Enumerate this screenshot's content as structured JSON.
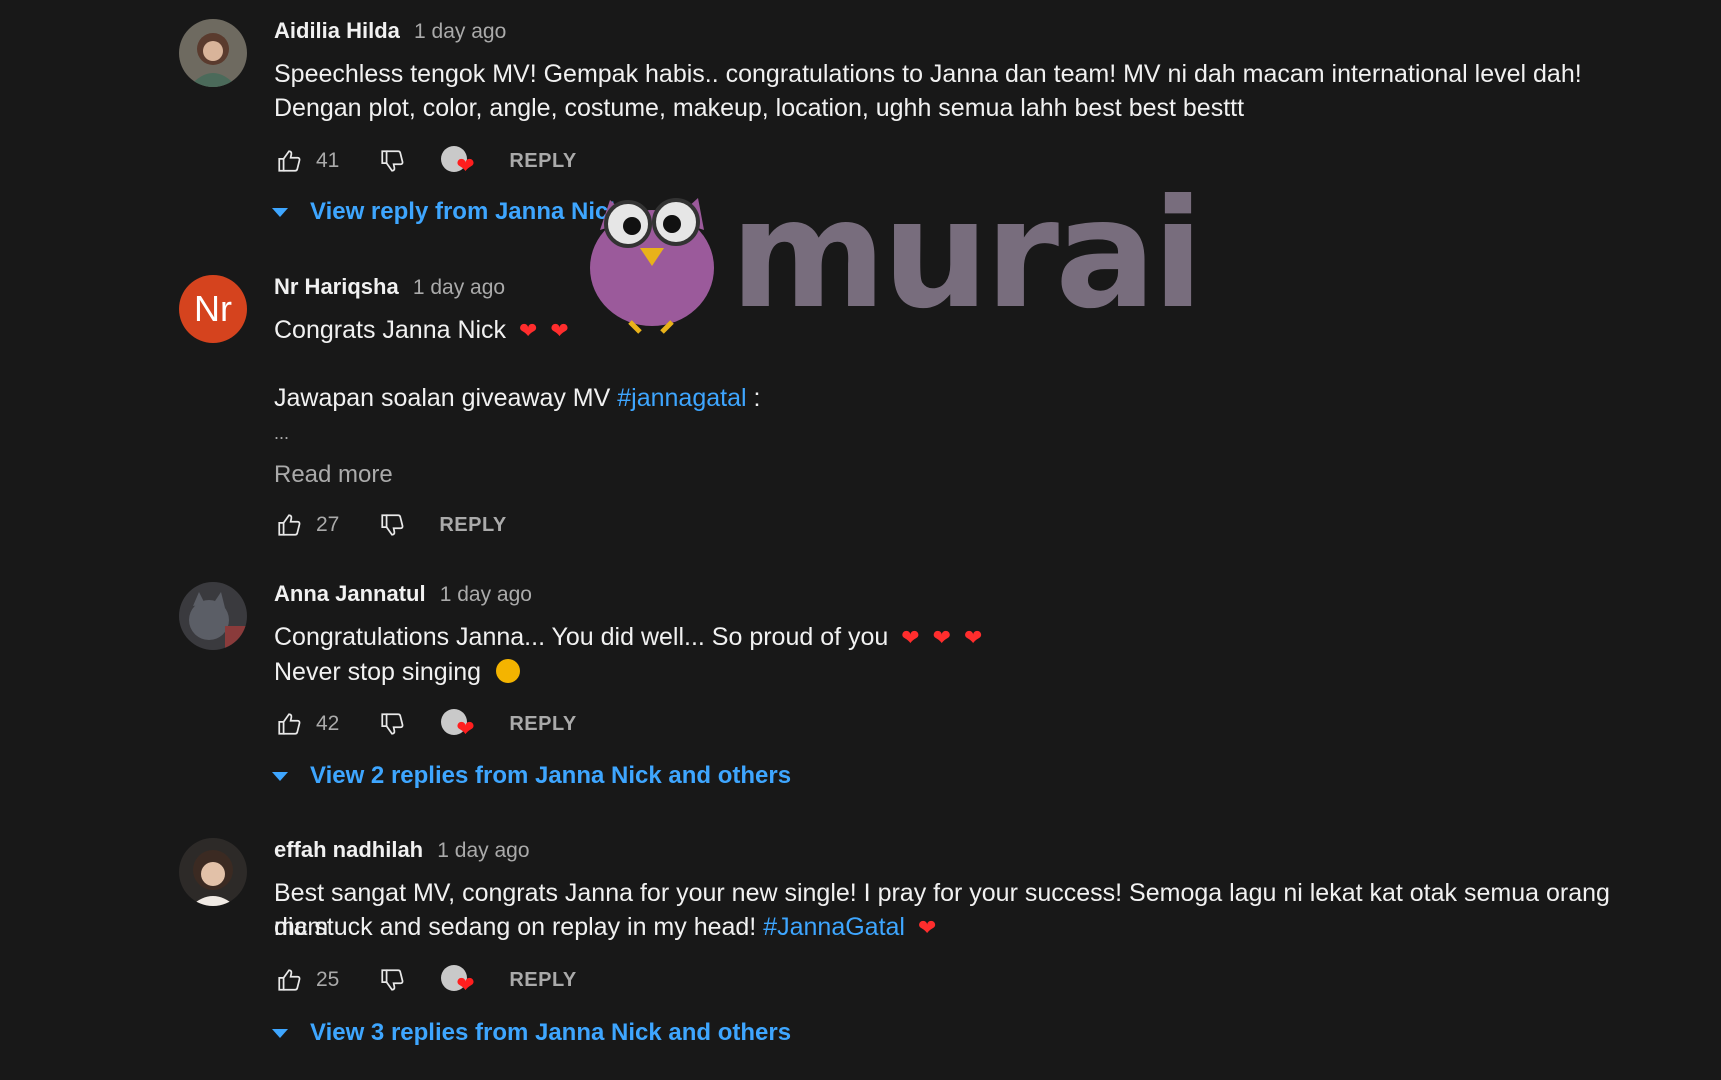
{
  "colors": {
    "background": "#181818",
    "link": "#3ea6ff",
    "muted": "#aaaaaa",
    "heart": "#ff2d2d"
  },
  "comments": [
    {
      "author": "Aidilia Hilda",
      "time": "1 day ago",
      "text_lines": [
        "Speechless tengok MV! Gempak habis.. congratulations to Janna dan team! MV ni dah macam international level dah! Dengan plot, color, angle, costume, makeup, location, ughh semua lahh best best besttt"
      ],
      "likes": "41",
      "reply_label": "REPLY",
      "view_replies": "View reply from Janna Nick"
    },
    {
      "author": "Nr Hariqsha",
      "avatar_letter": "Nr",
      "time": "1 day ago",
      "line1": "Congrats Janna Nick",
      "line2_prefix": "Jawapan soalan giveaway MV ",
      "line2_tag": "#jannagatal",
      "line2_suffix": " :",
      "ellipsis": "...",
      "read_more": "Read more",
      "likes": "27",
      "reply_label": "REPLY"
    },
    {
      "author": "Anna Jannatul",
      "time": "1 day ago",
      "line1": "Congratulations Janna... You did well... So proud of you",
      "line2": "Never stop singing",
      "likes": "42",
      "reply_label": "REPLY",
      "view_replies": "View 2 replies from Janna Nick and others"
    },
    {
      "author": "effah nadhilah",
      "time": "1 day ago",
      "line1": "Best sangat MV, congrats Janna for your new single! I pray for your success! Semoga lagu ni lekat kat otak semua orang mcm",
      "line2_prefix": "dia stuck and sedang on replay in my head! ",
      "line2_tag": "#JannaGatal",
      "likes": "25",
      "reply_label": "REPLY",
      "view_replies": "View 3 replies from Janna Nick and others"
    }
  ],
  "watermark": {
    "text": "murai"
  }
}
